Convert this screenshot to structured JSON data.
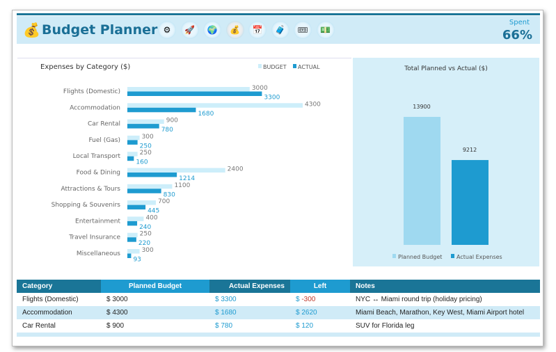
{
  "header": {
    "title": "Budget Planner",
    "spent_label": "Spent",
    "spent_value": "66%",
    "icons": [
      "gear-icon",
      "rocket-icon",
      "globe-icon",
      "money-bag-icon",
      "calendar-icon",
      "luggage-icon",
      "ticket-icon",
      "cash-icon"
    ]
  },
  "chart_data": [
    {
      "type": "bar",
      "orientation": "horizontal",
      "title": "Expenses by Category ($)",
      "legend": "top-right",
      "categories": [
        "Flights (Domestic)",
        "Accommodation",
        "Car Rental",
        "Fuel (Gas)",
        "Local Transport",
        "Food & Dining",
        "Attractions & Tours",
        "Shopping & Souvenirs",
        "Entertainment",
        "Travel Insurance",
        "Miscellaneous"
      ],
      "series": [
        {
          "name": "BUDGET",
          "color": "#cdeefa",
          "values": [
            3000,
            4300,
            900,
            300,
            250,
            2400,
            1100,
            700,
            400,
            250,
            300
          ]
        },
        {
          "name": "ACTUAL",
          "color": "#1e9bd0",
          "values": [
            3300,
            1680,
            780,
            250,
            160,
            1214,
            830,
            445,
            240,
            220,
            93
          ]
        }
      ]
    },
    {
      "type": "bar",
      "title": "Total Planned vs Actual ($)",
      "legend": "bottom",
      "categories": [
        "Planned Budget",
        "Actual Expenses"
      ],
      "values": [
        13900,
        9212
      ],
      "colors": [
        "#9fd9f0",
        "#1e9bd0"
      ]
    }
  ],
  "table": {
    "headers": [
      "Category",
      "Planned Budget",
      "Actual Expenses",
      "Left",
      "Notes"
    ],
    "rows": [
      [
        "Flights (Domestic)",
        "$ 3000",
        "$ 3300",
        "$ -300",
        "NYC ↔ Miami round trip (holiday pricing)"
      ],
      [
        "Accommodation",
        "$ 4300",
        "$ 1680",
        "$ 2620",
        "Miami Beach, Marathon, Key West, Miami Airport hotel"
      ],
      [
        "Car Rental",
        "$ 900",
        "$ 780",
        "$ 120",
        "SUV for Florida leg"
      ]
    ]
  }
}
